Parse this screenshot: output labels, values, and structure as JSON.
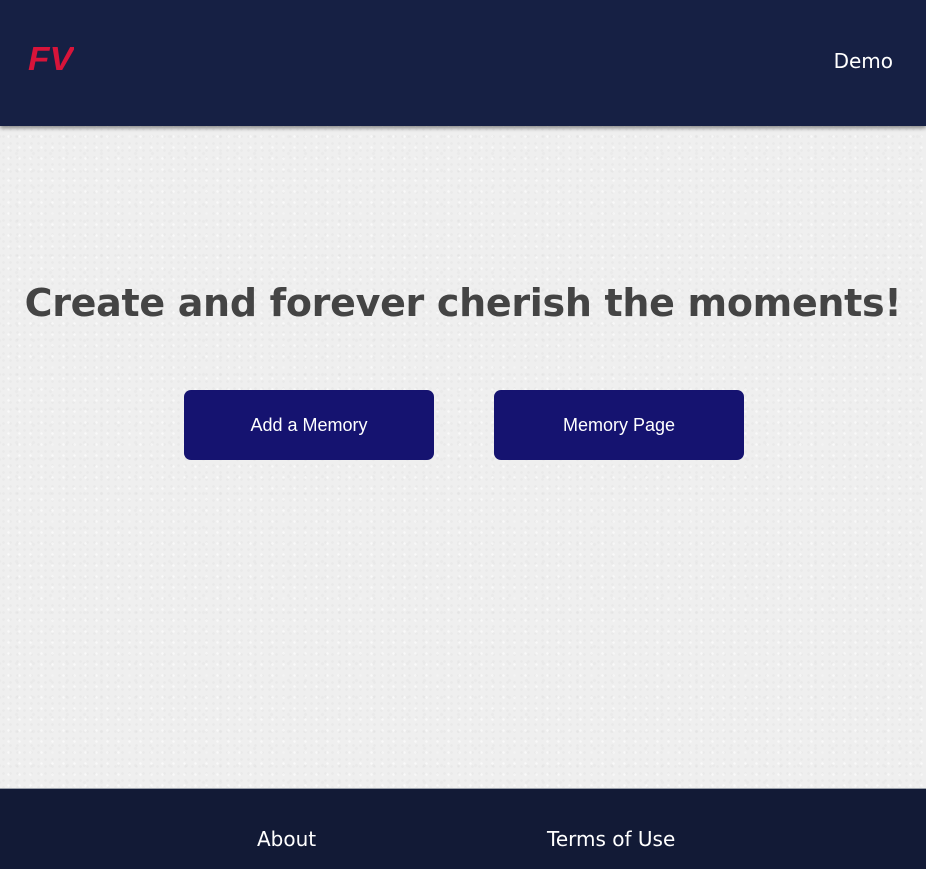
{
  "header": {
    "logo_text": "FV",
    "nav": {
      "demo_label": "Demo"
    }
  },
  "main": {
    "headline": "Create and forever cherish the moments!",
    "buttons": {
      "add_memory": "Add a Memory",
      "memory_page": "Memory Page"
    }
  },
  "footer": {
    "links": {
      "about": "About",
      "terms": "Terms of Use"
    }
  },
  "colors": {
    "header_bg": "#162044",
    "footer_bg": "#121a36",
    "button_bg": "#151370",
    "logo": "#d8143a",
    "headline_text": "#444444",
    "page_bg": "#efefef"
  },
  "icons": {
    "logo": "fv-logo-icon"
  }
}
